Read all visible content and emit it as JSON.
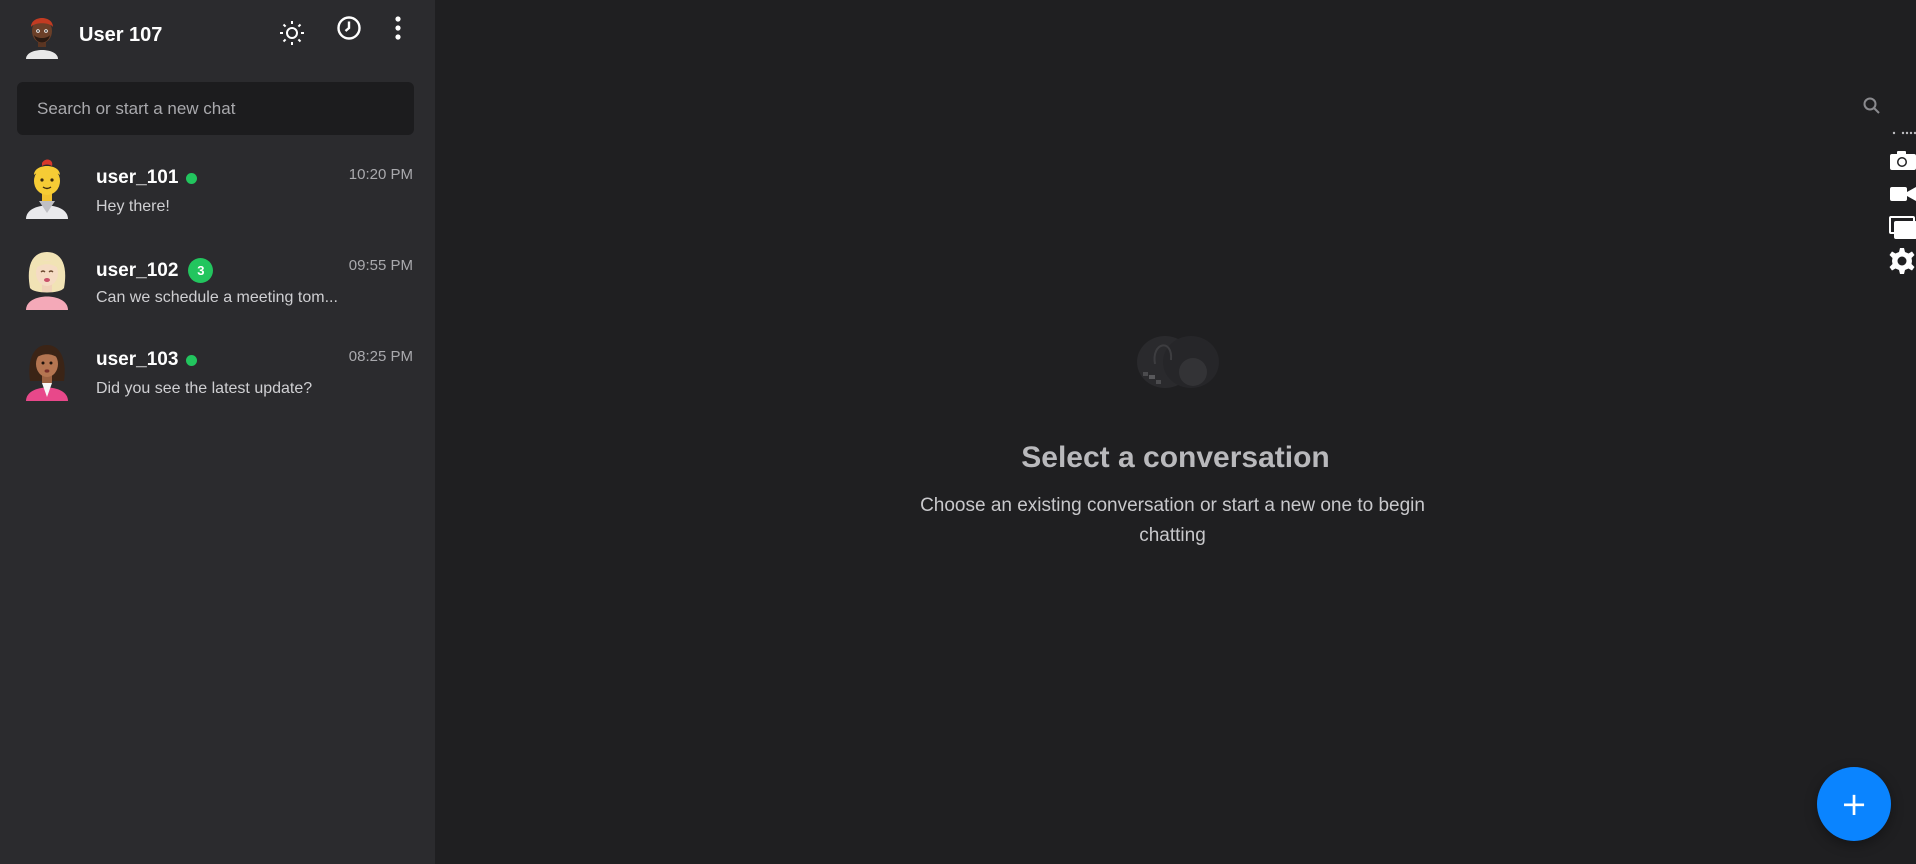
{
  "header": {
    "user_name": "User 107",
    "icons": [
      "sun-icon",
      "clock-icon",
      "kebab-menu-icon"
    ]
  },
  "search": {
    "placeholder": "Search or start a new chat",
    "value": ""
  },
  "chats": [
    {
      "name": "user_101",
      "preview": "Hey there!",
      "time": "10:20 PM",
      "online": true,
      "unread": null
    },
    {
      "name": "user_102",
      "preview": "Can we schedule a meeting tom...",
      "time": "09:55 PM",
      "online": false,
      "unread": "3"
    },
    {
      "name": "user_103",
      "preview": "Did you see the latest update?",
      "time": "08:25 PM",
      "online": true,
      "unread": null
    }
  ],
  "empty_state": {
    "title": "Select a conversation",
    "subtitle": "Choose an existing conversation or start a new one to begin chatting"
  },
  "right_toolbar": {
    "icons": [
      "search-icon",
      "more-dots-icon",
      "camera-icon",
      "video-icon",
      "screen-share-icon",
      "settings-icon"
    ]
  },
  "fab": {
    "label": "+"
  },
  "colors": {
    "sidebar_bg": "#2b2b2e",
    "main_bg": "#1f1f21",
    "search_bg": "#1c1c1e",
    "online": "#22c55e",
    "accent": "#0a84ff"
  }
}
